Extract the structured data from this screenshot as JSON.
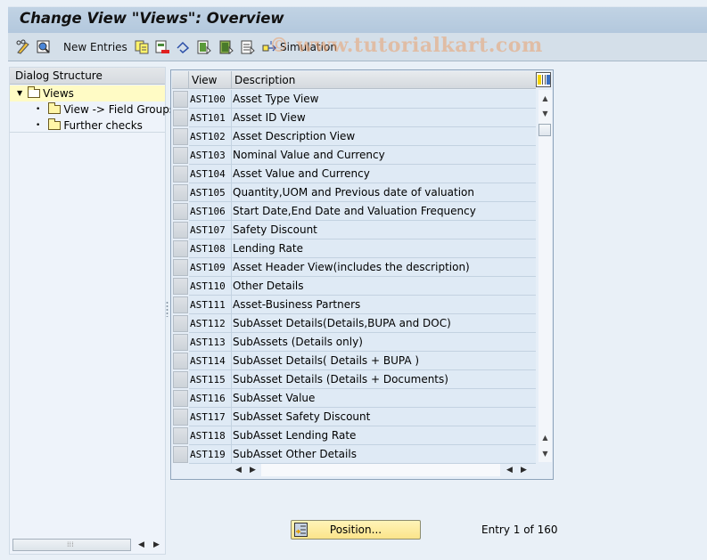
{
  "title": "Change View \"Views\": Overview",
  "toolbar": {
    "items": [
      {
        "name": "edit-toggle",
        "icon": "pencil-glasses-icon"
      },
      {
        "name": "details",
        "icon": "magnify-detail-icon"
      },
      {
        "name": "new-entries",
        "label": "New Entries"
      },
      {
        "name": "copy-as",
        "icon": "copy-icon"
      },
      {
        "name": "delete",
        "icon": "delete-row-icon"
      },
      {
        "name": "undo-change",
        "icon": "undo-icon"
      },
      {
        "name": "select-all",
        "icon": "select-all-icon"
      },
      {
        "name": "select-block",
        "icon": "select-block-icon"
      },
      {
        "name": "deselect-all",
        "icon": "deselect-all-icon"
      },
      {
        "name": "simulation",
        "icon": "simulation-icon",
        "label": "Simulation"
      }
    ]
  },
  "watermark": "© www.tutorialkart.com",
  "dialog_structure": {
    "header": "Dialog Structure",
    "items": [
      {
        "label": "Views",
        "level": 0,
        "expanded": true,
        "selected": true
      },
      {
        "label": "View -> Field Groups",
        "level": 1
      },
      {
        "label": "Further checks",
        "level": 1
      }
    ]
  },
  "table": {
    "columns": [
      "View",
      "Description"
    ],
    "rows": [
      {
        "view": "AST100",
        "description": "Asset Type View"
      },
      {
        "view": "AST101",
        "description": "Asset ID View"
      },
      {
        "view": "AST102",
        "description": "Asset Description View"
      },
      {
        "view": "AST103",
        "description": "Nominal Value and Currency"
      },
      {
        "view": "AST104",
        "description": "Asset Value and Currency"
      },
      {
        "view": "AST105",
        "description": "Quantity,UOM and Previous date of valuation"
      },
      {
        "view": "AST106",
        "description": "Start Date,End Date and Valuation Frequency"
      },
      {
        "view": "AST107",
        "description": "Safety Discount"
      },
      {
        "view": "AST108",
        "description": "Lending Rate"
      },
      {
        "view": "AST109",
        "description": "Asset Header View(includes the description)"
      },
      {
        "view": "AST110",
        "description": "Other Details"
      },
      {
        "view": "AST111",
        "description": "Asset-Business Partners"
      },
      {
        "view": "AST112",
        "description": "SubAsset Details(Details,BUPA and DOC)"
      },
      {
        "view": "AST113",
        "description": "SubAssets (Details only)"
      },
      {
        "view": "AST114",
        "description": "SubAsset Details( Details + BUPA )"
      },
      {
        "view": "AST115",
        "description": "SubAsset Details (Details + Documents)"
      },
      {
        "view": "AST116",
        "description": "SubAsset Value"
      },
      {
        "view": "AST117",
        "description": "SubAsset Safety Discount"
      },
      {
        "view": "AST118",
        "description": "SubAsset Lending Rate"
      },
      {
        "view": "AST119",
        "description": "SubAsset Other Details"
      }
    ]
  },
  "footer": {
    "position_label": "Position...",
    "entry_info": "Entry 1 of 160"
  },
  "colors": {
    "title_bg": "#b8cce0",
    "toolbar_bg": "#d4dfe9",
    "selected_tree": "#fffbc5",
    "button_yellow": "#fbe48a"
  }
}
